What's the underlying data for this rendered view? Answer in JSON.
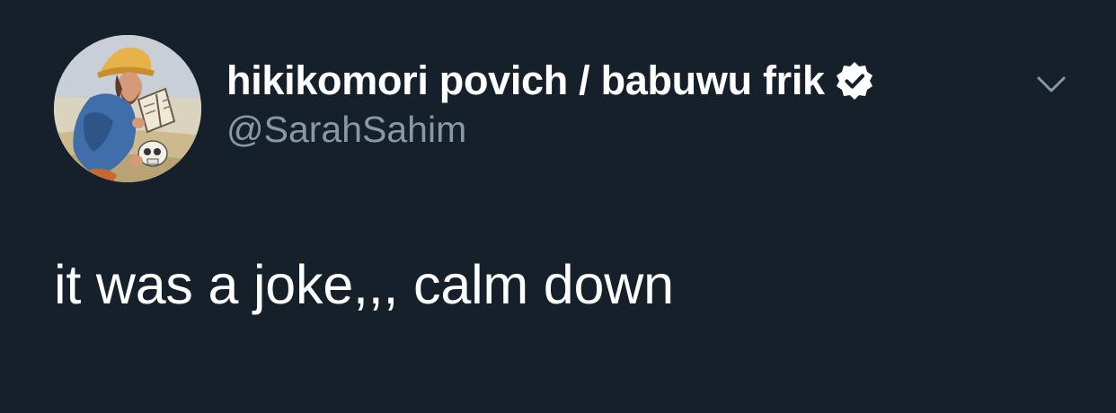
{
  "tweet": {
    "display_name": "hikikomori povich / babuwu frik",
    "handle": "@SarahSahim",
    "text": "it was a joke,,, calm down",
    "verified": true
  },
  "icons": {
    "verified": "verified-badge-icon",
    "menu": "chevron-down-icon"
  },
  "colors": {
    "background": "#16202b",
    "text": "#ffffff",
    "secondary_text": "#8899a6"
  }
}
